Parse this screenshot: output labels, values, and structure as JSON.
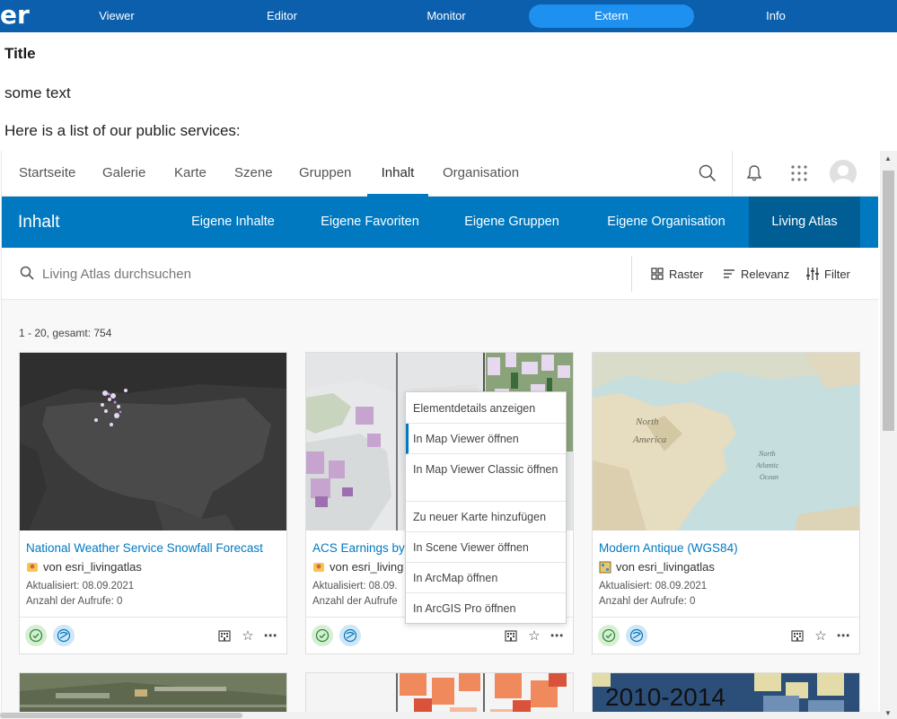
{
  "topnav": {
    "brand": "er",
    "items": [
      "Viewer",
      "Editor",
      "Monitor",
      "Extern",
      "Info"
    ],
    "active": "Extern",
    "colors": {
      "bar": "#0b5fad",
      "active_pill": "#1e90f0"
    }
  },
  "host": {
    "title": "Title",
    "text": "some text",
    "intro": "Here is a list of our public services:"
  },
  "arcgis": {
    "nav": {
      "items": [
        "Startseite",
        "Galerie",
        "Karte",
        "Szene",
        "Gruppen",
        "Inhalt",
        "Organisation"
      ],
      "active": "Inhalt",
      "icons": [
        "search-icon",
        "bell-icon",
        "app-launcher-icon",
        "avatar"
      ]
    },
    "subnav": {
      "title": "Inhalt",
      "tabs": [
        "Eigene Inhalte",
        "Eigene Favoriten",
        "Eigene Gruppen",
        "Eigene Organisation",
        "Living Atlas"
      ],
      "active": "Living Atlas",
      "colors": {
        "bar": "#0079c1",
        "active": "#005e95"
      }
    },
    "search": {
      "placeholder": "Living Atlas durchsuchen",
      "tools": [
        "Raster",
        "Relevanz",
        "Filter"
      ]
    },
    "results_count": "1 - 20, gesamt: 754",
    "cards": [
      {
        "title": "National Weather Service Snowfall Forecast",
        "owner": "von esri_livingatlas",
        "updated": "Aktualisiert: 08.09.2021",
        "views": "Anzahl der Aufrufe: 0"
      },
      {
        "title": "ACS Earnings by",
        "owner": "von esri_living",
        "updated": "Aktualisiert: 08.09.",
        "views": "Anzahl der Aufrufe"
      },
      {
        "title": "Modern Antique (WGS84)",
        "owner": "von esri_livingatlas",
        "updated": "Aktualisiert: 08.09.2021",
        "views": "Anzahl der Aufrufe: 0"
      }
    ],
    "context_menu": [
      "Elementdetails anzeigen",
      "In Map Viewer öffnen",
      "In Map Viewer Classic öffnen",
      "Zu neuer Karte hinzufügen",
      "In Scene Viewer öffnen",
      "In ArcMap öffnen",
      "In ArcGIS Pro öffnen"
    ],
    "context_menu_active": "In Map Viewer öffnen",
    "partial_card_text": "2010-2014"
  }
}
